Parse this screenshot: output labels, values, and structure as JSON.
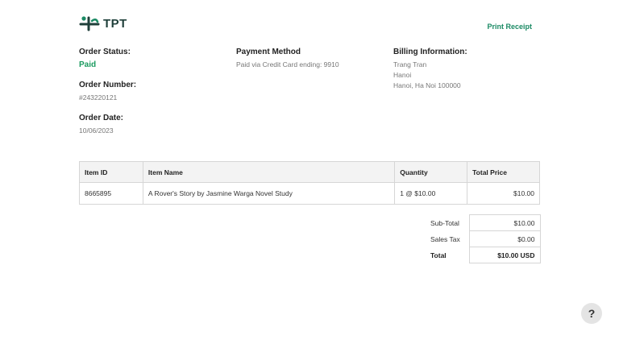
{
  "header": {
    "logo_text": "TPT",
    "print_label": "Print Receipt"
  },
  "order": {
    "status_label": "Order Status:",
    "status_value": "Paid",
    "number_label": "Order Number:",
    "number_value": "#243220121",
    "date_label": "Order Date:",
    "date_value": "10/06/2023"
  },
  "payment": {
    "label": "Payment Method",
    "value": "Paid via Credit Card ending: 9910"
  },
  "billing": {
    "label": "Billing Information:",
    "lines": [
      "Trang Tran",
      "Hanoi",
      "Hanoi, Ha Noi 100000"
    ]
  },
  "items_table": {
    "headers": [
      "Item ID",
      "Item Name",
      "Quantity",
      "Total Price"
    ],
    "rows": [
      [
        "8665895",
        "A Rover's Story by Jasmine Warga Novel Study",
        "1 @ $10.00",
        "$10.00"
      ]
    ]
  },
  "totals": [
    {
      "label": "Sub-Total",
      "value": "$10.00"
    },
    {
      "label": "Sales Tax",
      "value": "$0.00"
    },
    {
      "label": "Total",
      "value": "$10.00 USD"
    }
  ],
  "help": {
    "label": "?"
  },
  "colors": {
    "brand": "#1f3f3a",
    "accent": "#1b8a64",
    "paid": "#1b9a5f"
  },
  "icons": {
    "logo": "tpt-logo-icon",
    "help": "question-icon"
  }
}
